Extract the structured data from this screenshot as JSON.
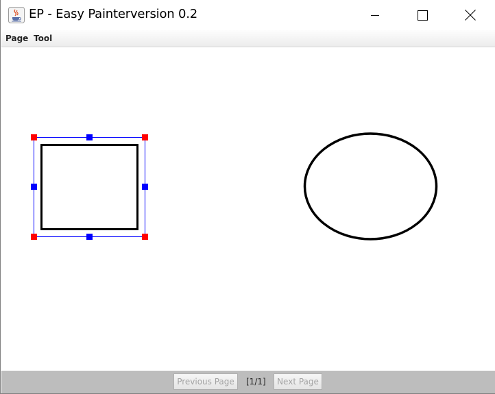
{
  "window": {
    "title": "EP - Easy Painterversion 0.2",
    "app_icon": "java-coffee-icon",
    "controls": [
      "minimize-icon",
      "maximize-icon",
      "close-icon"
    ]
  },
  "menu": {
    "items": [
      {
        "label": "Page"
      },
      {
        "label": "Tool"
      }
    ]
  },
  "canvas": {
    "shapes": [
      {
        "type": "rectangle",
        "selected": true
      },
      {
        "type": "ellipse",
        "selected": false
      }
    ],
    "colors": {
      "stroke": "#000000",
      "selection_frame": "#0000ff",
      "corner_handle": "#ff0000",
      "edge_handle": "#0000ff"
    }
  },
  "pagination": {
    "prev_label": "Previous Page",
    "next_label": "Next Page",
    "indicator": "[1/1]"
  }
}
